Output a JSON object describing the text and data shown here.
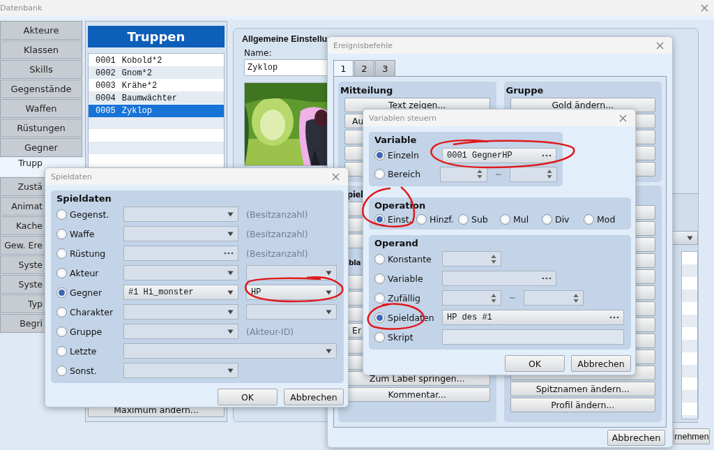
{
  "main_window": {
    "title": "Datenbank",
    "tabs": [
      {
        "label": "Akteure",
        "selected": false
      },
      {
        "label": "Klassen",
        "selected": false
      },
      {
        "label": "Skills",
        "selected": false
      },
      {
        "label": "Gegenstände",
        "selected": false
      },
      {
        "label": "Waffen",
        "selected": false
      },
      {
        "label": "Rüstungen",
        "selected": false
      },
      {
        "label": "Gegner",
        "selected": false
      },
      {
        "label": "Trupp",
        "selected": true
      },
      {
        "label": "Zustä",
        "selected": false
      },
      {
        "label": "Animat",
        "selected": false
      },
      {
        "label": "Kache",
        "selected": false
      },
      {
        "label": "Gew. Ere",
        "selected": false
      },
      {
        "label": "Syste",
        "selected": false
      },
      {
        "label": "Syste",
        "selected": false
      },
      {
        "label": "Typ",
        "selected": false
      },
      {
        "label": "Begri",
        "selected": false
      }
    ],
    "troops": {
      "title": "Truppen",
      "rows": [
        {
          "id": "0001",
          "name": "Kobold*2",
          "selected": false
        },
        {
          "id": "0002",
          "name": "Gnom*2",
          "selected": false
        },
        {
          "id": "0003",
          "name": "Krähe*2",
          "selected": false
        },
        {
          "id": "0004",
          "name": "Baumwächter",
          "selected": false
        },
        {
          "id": "0005",
          "name": "Zyklop",
          "selected": true
        }
      ],
      "maximum_button": "Maximum ändern..."
    },
    "general": {
      "title": "Allgemeine Einstellu",
      "name_label": "Name:",
      "name_value": "Zyklop"
    },
    "apply_button": "rnehmen"
  },
  "event_commands": {
    "title": "Ereignisbefehle",
    "tabs": [
      {
        "label": "1",
        "selected": true
      },
      {
        "label": "2",
        "selected": false
      },
      {
        "label": "3",
        "selected": false
      }
    ],
    "groups": [
      {
        "title": "Mitteilung",
        "items": [
          {
            "kind": "button",
            "label": "Text zeigen..."
          },
          {
            "kind": "partial",
            "label": "Au"
          },
          {
            "kind": "blank"
          },
          {
            "kind": "blank"
          },
          {
            "kind": "blank"
          }
        ]
      },
      {
        "title": "Gruppe",
        "items": [
          {
            "kind": "button",
            "label": "Gold ändern..."
          },
          {
            "kind": "blank"
          },
          {
            "kind": "blank"
          },
          {
            "kind": "blank"
          },
          {
            "kind": "blank"
          }
        ]
      },
      {
        "title": "piel",
        "items": [
          {
            "kind": "blank"
          },
          {
            "kind": "blank"
          },
          {
            "kind": "blank"
          },
          {
            "kind": "heading",
            "label": "bla"
          },
          {
            "kind": "blank"
          },
          {
            "kind": "blank"
          },
          {
            "kind": "blank"
          },
          {
            "kind": "partial",
            "label": "Er"
          },
          {
            "kind": "blank"
          },
          {
            "kind": "blank"
          },
          {
            "kind": "button",
            "label": "Zum Label springen..."
          },
          {
            "kind": "button",
            "label": "Kommentar..."
          }
        ]
      },
      {
        "items": [
          {
            "kind": "blank"
          },
          {
            "kind": "blank"
          },
          {
            "kind": "blank"
          },
          {
            "kind": "blank"
          },
          {
            "kind": "blank"
          },
          {
            "kind": "blank"
          },
          {
            "kind": "blank"
          },
          {
            "kind": "blank"
          },
          {
            "kind": "blank"
          },
          {
            "kind": "blank"
          },
          {
            "kind": "blank"
          },
          {
            "kind": "button",
            "label": "Spitznamen ändern..."
          },
          {
            "kind": "button",
            "label": "Profil ändern..."
          }
        ]
      }
    ],
    "cancel_button": "Abbrechen"
  },
  "variables_dialog": {
    "title": "Variablen steuern",
    "variable": {
      "title": "Variable",
      "options": [
        {
          "label": "Einzeln",
          "selected": true,
          "kind": "picker",
          "value": "0001 GegnerHP"
        },
        {
          "label": "Bereich",
          "selected": false,
          "kind": "range",
          "separator": "~"
        }
      ]
    },
    "operation": {
      "title": "Operation",
      "options": [
        {
          "label": "Einst.",
          "selected": true
        },
        {
          "label": "Hinzf.",
          "selected": false
        },
        {
          "label": "Sub",
          "selected": false
        },
        {
          "label": "Mul",
          "selected": false
        },
        {
          "label": "Div",
          "selected": false
        },
        {
          "label": "Mod",
          "selected": false
        }
      ]
    },
    "operand": {
      "title": "Operand",
      "options": [
        {
          "label": "Konstante",
          "selected": false,
          "kind": "spin"
        },
        {
          "label": "Variable",
          "selected": false,
          "kind": "picker"
        },
        {
          "label": "Zufällig",
          "selected": false,
          "kind": "range",
          "separator": "~"
        },
        {
          "label": "Spieldaten",
          "selected": true,
          "kind": "wide_picker",
          "value": "HP des #1"
        },
        {
          "label": "Skript",
          "selected": false,
          "kind": "text"
        }
      ]
    },
    "ok_button": "OK",
    "cancel_button": "Abbrechen"
  },
  "game_data_dialog": {
    "title": "Spieldaten",
    "group_title": "Spieldaten",
    "rows": [
      {
        "label": "Gegenst.",
        "selected": false,
        "kind": "combo_note",
        "note": "(Besitzanzahl)"
      },
      {
        "label": "Waffe",
        "selected": false,
        "kind": "combo_note",
        "note": "(Besitzanzahl)"
      },
      {
        "label": "Rüstung",
        "selected": false,
        "kind": "picker_note",
        "note": "(Besitzanzahl)"
      },
      {
        "label": "Akteur",
        "selected": false,
        "kind": "two_combos"
      },
      {
        "label": "Gegner",
        "selected": true,
        "kind": "two_combos",
        "value": "#1 Hi_monster",
        "value_2": "HP"
      },
      {
        "label": "Charakter",
        "selected": false,
        "kind": "two_combos"
      },
      {
        "label": "Gruppe",
        "selected": false,
        "kind": "combo_note",
        "note": "(Akteur-ID)"
      },
      {
        "label": "Letzte",
        "selected": false,
        "kind": "wide_combo"
      },
      {
        "label": "Sonst.",
        "selected": false,
        "kind": "combo"
      }
    ],
    "ok_button": "OK",
    "cancel_button": "Abbrechen"
  }
}
